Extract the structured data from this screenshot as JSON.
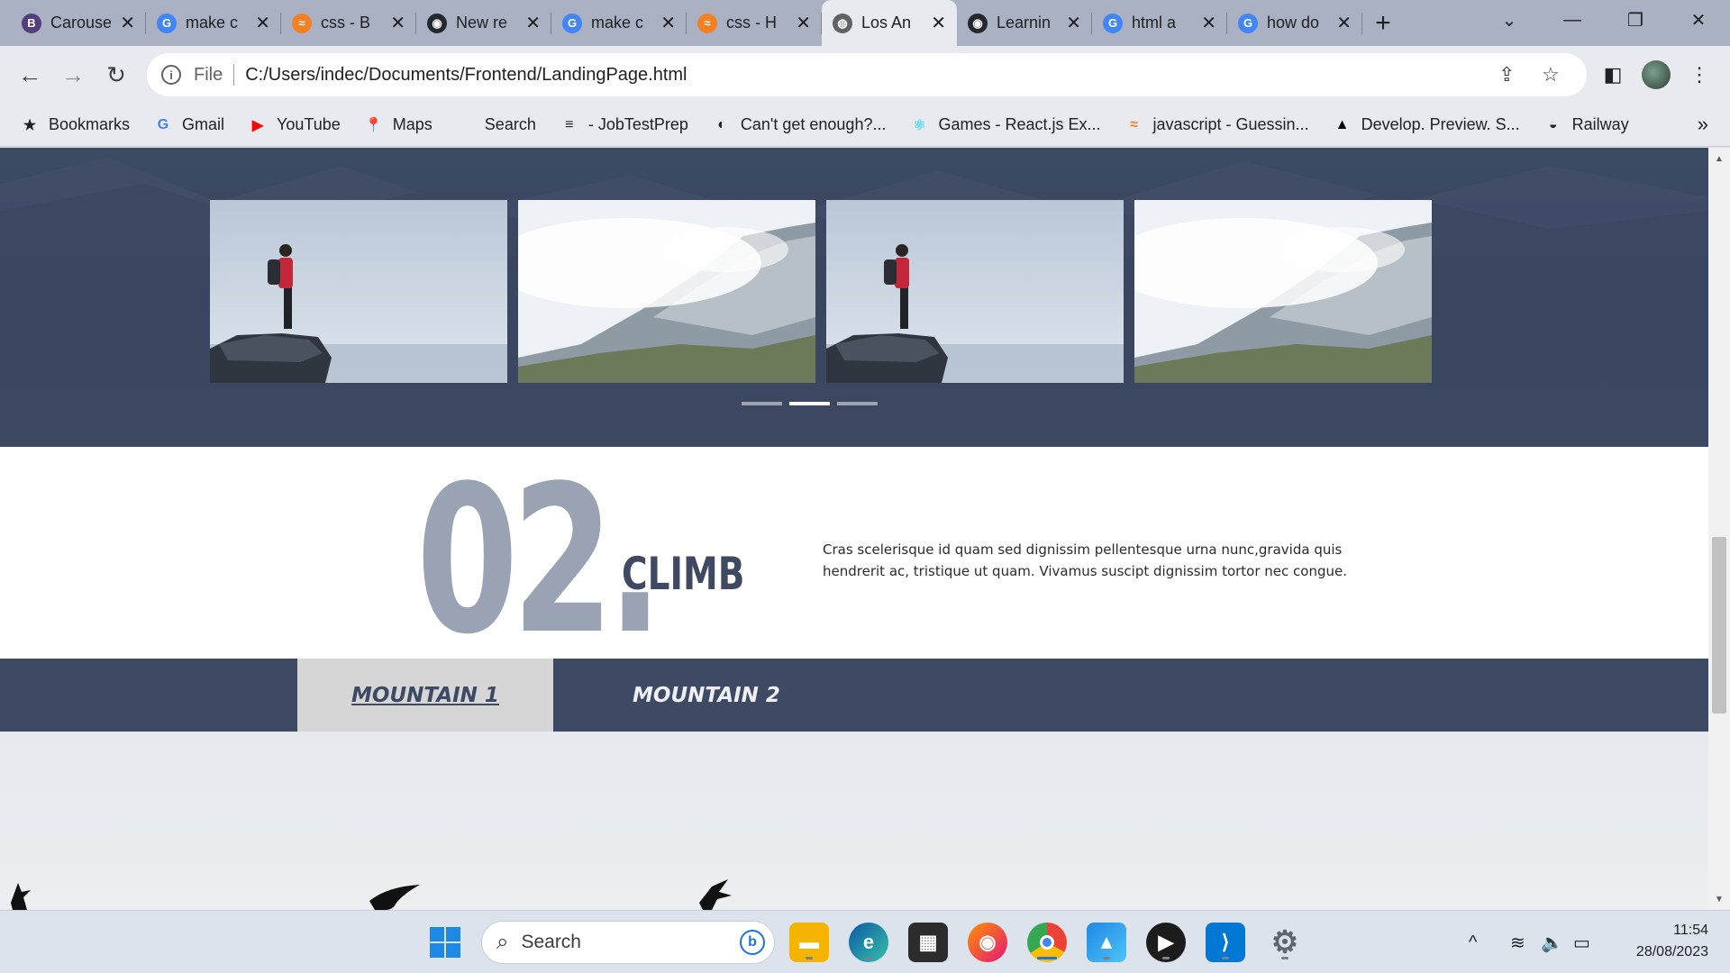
{
  "browser": {
    "tabs": [
      {
        "title": "Carousel",
        "favicon": "bootstrap-icon",
        "color": "#563d7c",
        "glyph": "B",
        "active": false
      },
      {
        "title": "make c",
        "favicon": "google-icon",
        "color": "#4285f4",
        "glyph": "G",
        "active": false
      },
      {
        "title": "css - B",
        "favicon": "stackoverflow-icon",
        "color": "#f48024",
        "glyph": "≈",
        "active": false
      },
      {
        "title": "New re",
        "favicon": "github-icon",
        "color": "#24292e",
        "glyph": "◉",
        "active": false
      },
      {
        "title": "make c",
        "favicon": "google-icon",
        "color": "#4285f4",
        "glyph": "G",
        "active": false
      },
      {
        "title": "css - H",
        "favicon": "stackoverflow-icon",
        "color": "#f48024",
        "glyph": "≈",
        "active": false
      },
      {
        "title": "Los An",
        "favicon": "globe-icon",
        "color": "#5f6368",
        "glyph": "◍",
        "active": true
      },
      {
        "title": "Learnin",
        "favicon": "github-icon",
        "color": "#24292e",
        "glyph": "◉",
        "active": false
      },
      {
        "title": "html a",
        "favicon": "google-icon",
        "color": "#4285f4",
        "glyph": "G",
        "active": false
      },
      {
        "title": "how do",
        "favicon": "google-icon",
        "color": "#4285f4",
        "glyph": "G",
        "active": false
      }
    ],
    "address": {
      "scheme": "File",
      "url": "C:/Users/indec/Documents/Frontend/LandingPage.html"
    },
    "bookmarks": [
      {
        "label": "Bookmarks",
        "icon": "star-icon",
        "glyph": "★",
        "color": "#202124"
      },
      {
        "label": "Gmail",
        "icon": "google-icon",
        "glyph": "G",
        "color": "#4285f4"
      },
      {
        "label": "YouTube",
        "icon": "youtube-icon",
        "glyph": "▶",
        "color": "#ff0000"
      },
      {
        "label": "Maps",
        "icon": "maps-pin-icon",
        "glyph": "📍",
        "color": "#34a853"
      },
      {
        "label": "Search",
        "icon": "blank-icon",
        "glyph": "",
        "color": "#202124"
      },
      {
        "label": "- JobTestPrep",
        "icon": "list-icon",
        "glyph": "≡",
        "color": "#202124"
      },
      {
        "label": "Can't get enough?...",
        "icon": "circle-icon",
        "glyph": "◐",
        "color": "#202124"
      },
      {
        "label": "Games - React.js Ex...",
        "icon": "react-icon",
        "glyph": "⚛",
        "color": "#61dafb"
      },
      {
        "label": "javascript - Guessin...",
        "icon": "stackoverflow-icon",
        "glyph": "≈",
        "color": "#f48024"
      },
      {
        "label": "Develop. Preview. S...",
        "icon": "vercel-icon",
        "glyph": "▲",
        "color": "#000000"
      },
      {
        "label": "Railway",
        "icon": "railway-icon",
        "glyph": "◒",
        "color": "#202124"
      }
    ]
  },
  "page": {
    "carousel": {
      "images": [
        "hiker-on-rock",
        "misty-mountain",
        "hiker-on-rock",
        "misty-mountain"
      ],
      "indicator_count": 3,
      "active_indicator": 2
    },
    "section": {
      "number": "02.",
      "word": "CLIMB",
      "text": "Cras scelerisque id quam sed dignissim pellentesque urna nunc,gravida quis hendrerit ac, tristique ut quam. Vivamus suscipt dignissim tortor nec congue."
    },
    "tabs": [
      {
        "label": "MOUNTAIN 1",
        "active": true
      },
      {
        "label": "MOUNTAIN 2",
        "active": false
      }
    ],
    "colors": {
      "navy": "#3e4a64",
      "slate": "#9aa3b3",
      "active_tab": "#d6d6d6"
    }
  },
  "taskbar": {
    "search_placeholder": "Search",
    "apps": [
      "windows-start-icon",
      "file-explorer-icon",
      "edge-icon",
      "store-icon",
      "firefox-icon",
      "chrome-icon",
      "photos-icon",
      "media-player-icon",
      "vscode-icon",
      "settings-icon"
    ],
    "time": "11:54",
    "date": "28/08/2023"
  }
}
